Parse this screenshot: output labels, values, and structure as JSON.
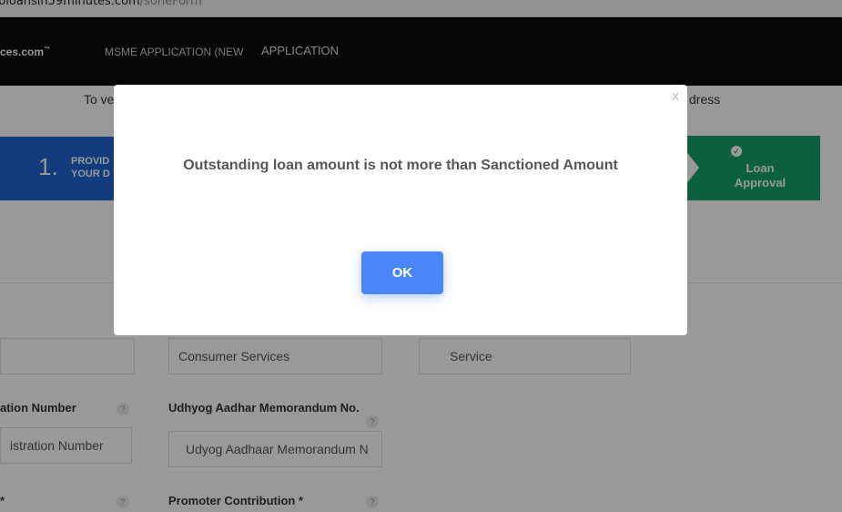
{
  "browser": {
    "url_host": "bloansin59minutes.com",
    "url_path": "/soneForm"
  },
  "nav": {
    "brand": "ces.com",
    "brand_tm": "™",
    "item1": "MSME APPLICATION (NEW",
    "item2": "APPLICATION"
  },
  "notice": {
    "left": "To ve",
    "right": "dress"
  },
  "steps": {
    "first_number": "1.",
    "first_label_l1": "PROVID",
    "first_label_l2": "YOUR D",
    "last_label_l1": "Loan",
    "last_label_l2": "Approval"
  },
  "form": {
    "row1": {
      "field_b": "Consumer Services",
      "field_c": "Service"
    },
    "row2": {
      "label_a": "ation Number",
      "field_a_placeholder": "istration Number",
      "label_b": "Udhyog Aadhar Memorandum No.",
      "field_b_placeholder": "Udyog Aadhaar Memorandum N"
    },
    "row3": {
      "label_a": "*",
      "label_b": "Promoter Contribution *"
    },
    "help_glyph": "?"
  },
  "dialog": {
    "close_glyph": "x",
    "message": "Outstanding loan amount is not more than Sanctioned Amount",
    "ok_label": "OK"
  }
}
